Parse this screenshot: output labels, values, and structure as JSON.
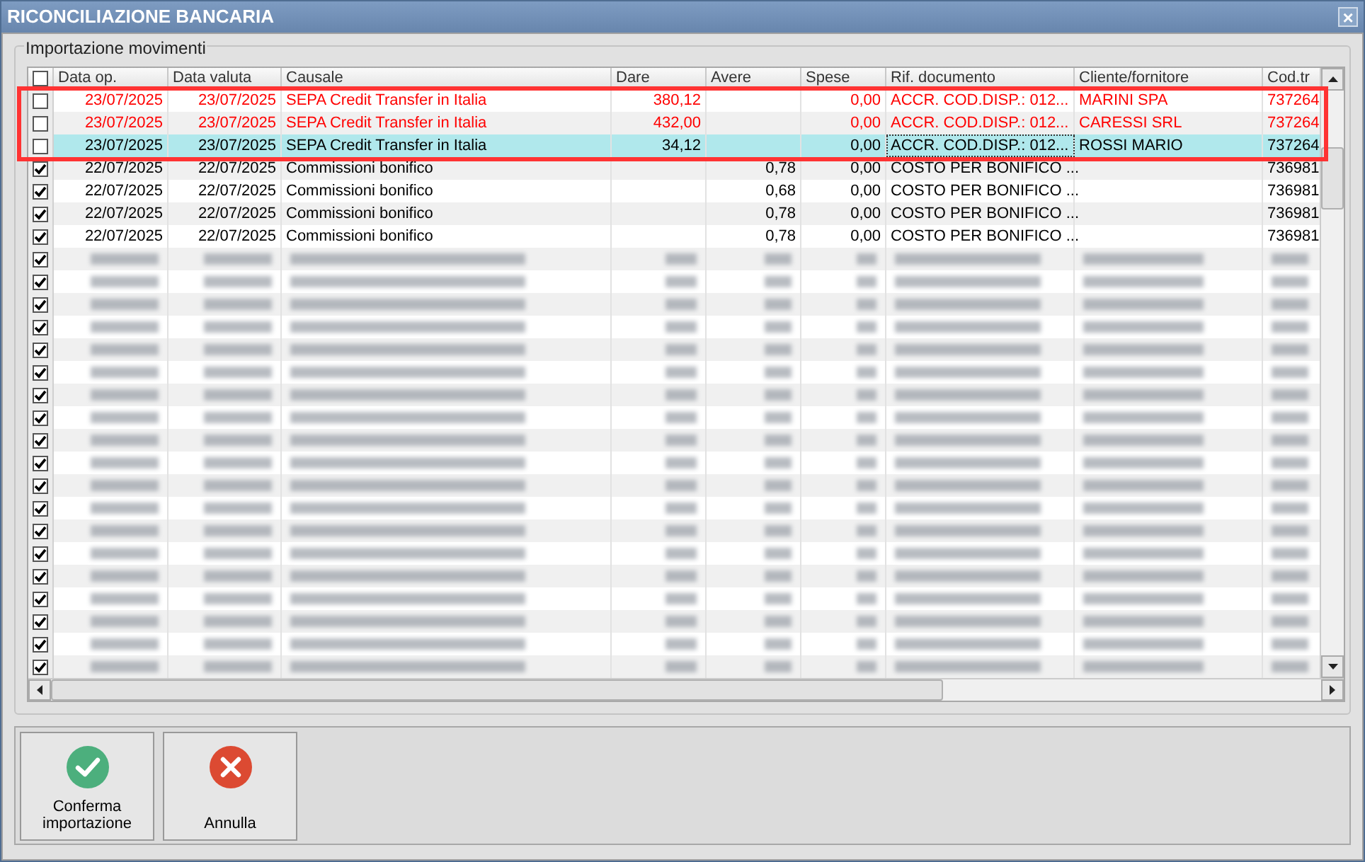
{
  "window": {
    "title": "RICONCILIAZIONE BANCARIA",
    "close": "×"
  },
  "group": {
    "title": "Importazione movimenti"
  },
  "table": {
    "header_checked": false,
    "columns": [
      "Data op.",
      "Data valuta",
      "Causale",
      "Dare",
      "Avere",
      "Spese",
      "Rif. documento",
      "Cliente/fornitore",
      "Cod.tr"
    ],
    "rows": [
      {
        "kind": "data",
        "checked": false,
        "selected": false,
        "color": "#ff0000",
        "cells": [
          "23/07/2025",
          "23/07/2025",
          "SEPA Credit Transfer in Italia",
          "380,12",
          "",
          "0,00",
          "ACCR. COD.DISP.: 012...",
          "MARINI SPA",
          "737264"
        ]
      },
      {
        "kind": "data",
        "checked": false,
        "selected": false,
        "color": "#ff0000",
        "cells": [
          "23/07/2025",
          "23/07/2025",
          "SEPA Credit Transfer in Italia",
          "432,00",
          "",
          "0,00",
          "ACCR. COD.DISP.: 012...",
          "CARESSI SRL",
          "737264"
        ]
      },
      {
        "kind": "data",
        "checked": false,
        "selected": true,
        "color": "#000000",
        "cells": [
          "23/07/2025",
          "23/07/2025",
          "SEPA Credit Transfer in Italia",
          "34,12",
          "",
          "0,00",
          "ACCR. COD.DISP.: 012...",
          "ROSSI MARIO",
          "737264"
        ]
      },
      {
        "kind": "data",
        "checked": true,
        "selected": false,
        "color": "#000000",
        "cells": [
          "22/07/2025",
          "22/07/2025",
          "Commissioni bonifico",
          "",
          "0,78",
          "0,00",
          "COSTO PER BONIFICO ...",
          "",
          "736981"
        ]
      },
      {
        "kind": "data",
        "checked": true,
        "selected": false,
        "color": "#000000",
        "cells": [
          "22/07/2025",
          "22/07/2025",
          "Commissioni bonifico",
          "",
          "0,68",
          "0,00",
          "COSTO PER BONIFICO ...",
          "",
          "736981"
        ]
      },
      {
        "kind": "data",
        "checked": true,
        "selected": false,
        "color": "#000000",
        "cells": [
          "22/07/2025",
          "22/07/2025",
          "Commissioni bonifico",
          "",
          "0,78",
          "0,00",
          "COSTO PER BONIFICO ...",
          "",
          "736981"
        ]
      },
      {
        "kind": "data",
        "checked": true,
        "selected": false,
        "color": "#000000",
        "cells": [
          "22/07/2025",
          "22/07/2025",
          "Commissioni bonifico",
          "",
          "0,78",
          "0,00",
          "COSTO PER BONIFICO ...",
          "",
          "736981"
        ]
      },
      {
        "kind": "redacted",
        "checked": true
      },
      {
        "kind": "redacted",
        "checked": true
      },
      {
        "kind": "redacted",
        "checked": true
      },
      {
        "kind": "redacted",
        "checked": true
      },
      {
        "kind": "redacted",
        "checked": true
      },
      {
        "kind": "redacted",
        "checked": true
      },
      {
        "kind": "redacted",
        "checked": true
      },
      {
        "kind": "redacted",
        "checked": true
      },
      {
        "kind": "redacted",
        "checked": true
      },
      {
        "kind": "redacted",
        "checked": true
      },
      {
        "kind": "redacted",
        "checked": true
      },
      {
        "kind": "redacted",
        "checked": true
      },
      {
        "kind": "redacted",
        "checked": true
      },
      {
        "kind": "redacted",
        "checked": true
      },
      {
        "kind": "redacted",
        "checked": true
      },
      {
        "kind": "redacted",
        "checked": true
      },
      {
        "kind": "redacted",
        "checked": true
      },
      {
        "kind": "redacted",
        "checked": true
      },
      {
        "kind": "redacted",
        "checked": true
      }
    ]
  },
  "buttons": [
    {
      "kind": "confirm",
      "label": "Conferma importazione"
    },
    {
      "kind": "cancel",
      "label": "Annulla"
    }
  ]
}
